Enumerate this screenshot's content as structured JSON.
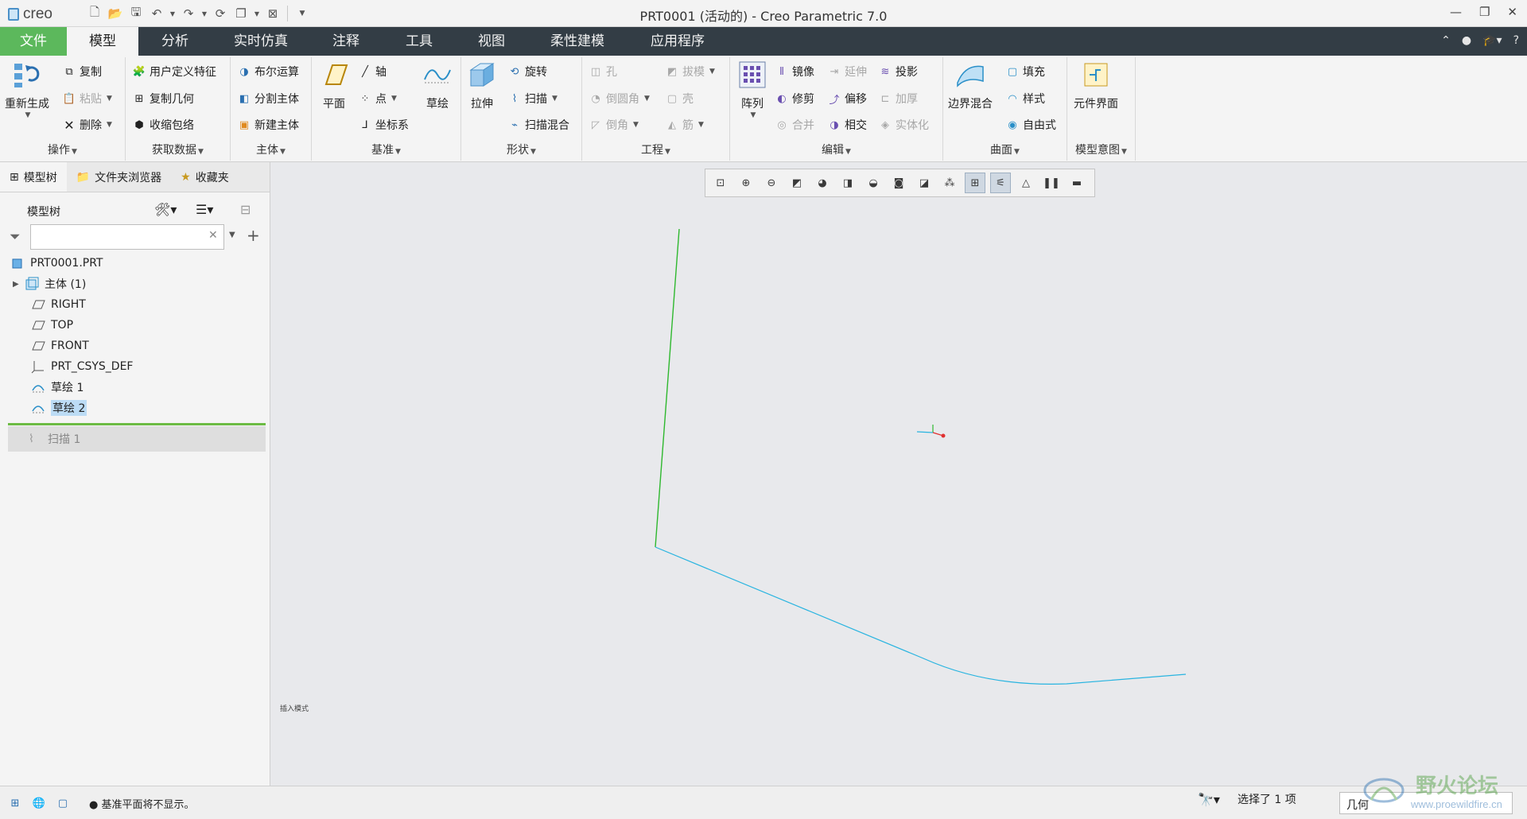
{
  "app": {
    "logo_text": "creo",
    "window_title": "PRT0001 (活动的) - Creo Parametric 7.0"
  },
  "tabs": [
    "文件",
    "模型",
    "分析",
    "实时仿真",
    "注释",
    "工具",
    "视图",
    "柔性建模",
    "应用程序"
  ],
  "active_tab": "模型",
  "ribbon": {
    "operations": {
      "label": "操作",
      "regenerate": "重新生成",
      "copy": "复制",
      "paste": "粘贴",
      "delete": "删除"
    },
    "get_data": {
      "label": "获取数据",
      "udf": "用户定义特征",
      "copy_geom": "复制几何",
      "shrinkwrap": "收缩包络"
    },
    "body": {
      "label": "主体",
      "boolean": "布尔运算",
      "split": "分割主体",
      "new_body": "新建主体"
    },
    "datum": {
      "label": "基准",
      "plane": "平面",
      "axis": "轴",
      "point": "点",
      "csys": "坐标系",
      "sketch": "草绘"
    },
    "shapes": {
      "label": "形状",
      "extrude": "拉伸",
      "revolve": "旋转",
      "sweep": "扫描",
      "swept_blend": "扫描混合"
    },
    "engineering": {
      "label": "工程",
      "hole": "孔",
      "draft": "拔模",
      "round": "倒圆角",
      "shell": "壳",
      "chamfer": "倒角",
      "rib": "筋"
    },
    "editing": {
      "label": "编辑",
      "pattern": "阵列",
      "mirror": "镜像",
      "extend": "延伸",
      "project": "投影",
      "trim": "修剪",
      "offset": "偏移",
      "thicken": "加厚",
      "merge": "合并",
      "intersect": "相交",
      "solidify": "实体化"
    },
    "surfaces": {
      "label": "曲面",
      "boundary_blend": "边界混合",
      "fill": "填充",
      "style": "样式",
      "freestyle": "自由式"
    },
    "model_intent": {
      "label": "模型意图",
      "component_interface": "元件界面"
    }
  },
  "left_panel": {
    "tabs": [
      "模型树",
      "文件夹浏览器",
      "收藏夹"
    ],
    "tree_title": "模型树",
    "search_value": "",
    "tree_items": [
      {
        "label": "PRT0001.PRT",
        "icon": "part-icon"
      },
      {
        "label": "主体 (1)",
        "icon": "body-icon"
      },
      {
        "label": "RIGHT",
        "icon": "datum-plane-icon"
      },
      {
        "label": "TOP",
        "icon": "datum-plane-icon"
      },
      {
        "label": "FRONT",
        "icon": "datum-plane-icon"
      },
      {
        "label": "PRT_CSYS_DEF",
        "icon": "csys-icon"
      },
      {
        "label": "草绘 1",
        "icon": "sketch-icon"
      },
      {
        "label": "草绘 2",
        "icon": "sketch-icon"
      }
    ],
    "selected_item": "草绘 2",
    "after_insert_item": "扫描 1"
  },
  "graphics": {
    "tiny_note": "插入模式"
  },
  "statusbar": {
    "message": "基准平面将不显示。",
    "selection": "选择了 1 项",
    "filter": "几何"
  },
  "watermark": {
    "text": "野火论坛",
    "url": "www.proewildfire.cn"
  },
  "colors": {
    "file_tab": "#5cb85c",
    "tabbar_bg": "#333d45",
    "curve_green": "#2eb82e",
    "curve_cyan": "#28b4e0",
    "selection": "#bcdcf5",
    "insert_line": "#6cbb44"
  }
}
